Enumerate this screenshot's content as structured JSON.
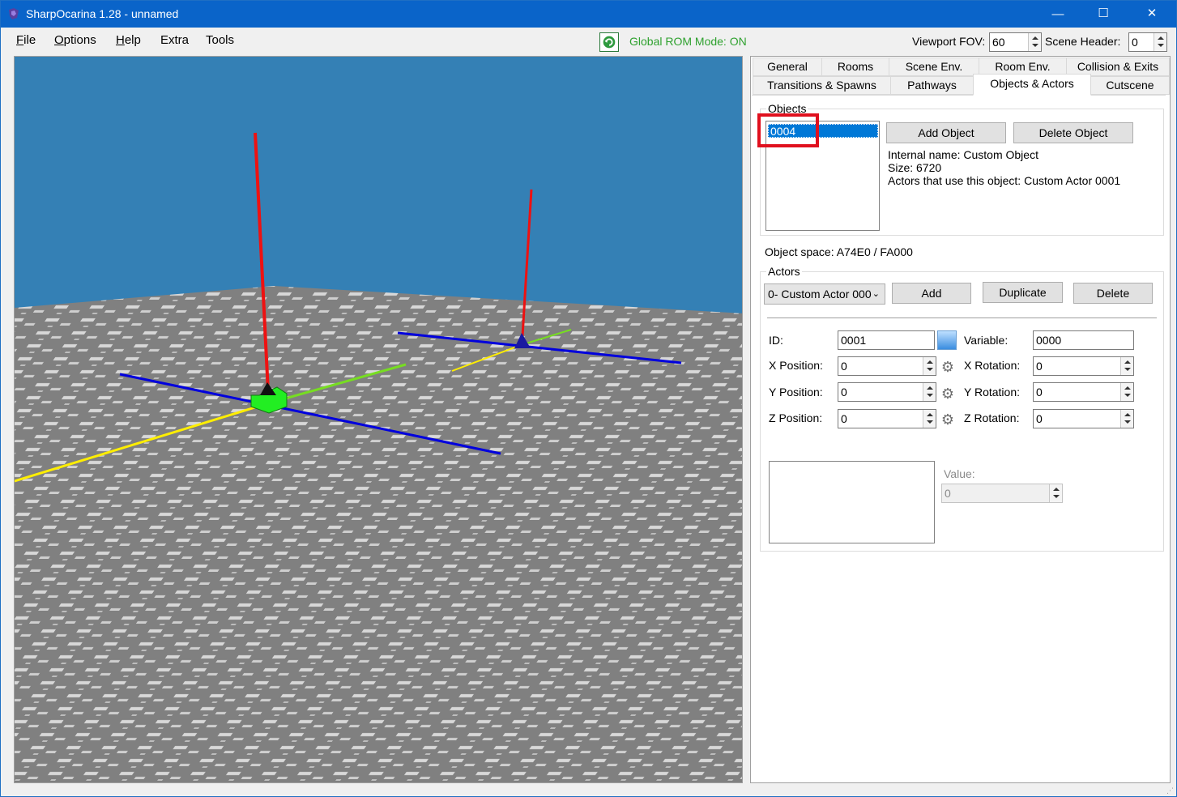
{
  "window": {
    "title": "SharpOcarina 1.28 - unnamed",
    "controls": {
      "minimize": "—",
      "maximize": "☐",
      "close": "✕"
    }
  },
  "menu": {
    "items": [
      {
        "first": "F",
        "rest": "ile"
      },
      {
        "first": "O",
        "rest": "ptions"
      },
      {
        "first": "H",
        "rest": "elp"
      },
      {
        "first": "",
        "rest": "Extra"
      },
      {
        "first": "",
        "rest": "Tools"
      }
    ]
  },
  "toolbar": {
    "rom_mode": "Global ROM Mode: ON",
    "rom_mode_color": "#2ea12e",
    "fov_label": "Viewport FOV:",
    "fov_value": "60",
    "scene_header_label": "Scene Header:",
    "scene_header_value": "0"
  },
  "viewport": {
    "sky_color": "#3480b5",
    "floor_color": "#7e7e7e",
    "axis_colors": {
      "x": "#0000dd",
      "y": "#ee1111",
      "z": "#ffee00",
      "z_alt": "#77dd22"
    }
  },
  "tabs": {
    "row1": [
      "General",
      "Rooms",
      "Scene Env.",
      "Room Env.",
      "Collision & Exits"
    ],
    "row2": [
      "Transitions & Spawns",
      "Pathways",
      "Objects & Actors",
      "Cutscene"
    ],
    "active": "Objects & Actors"
  },
  "objects": {
    "group_title": "Objects",
    "list": [
      "0004"
    ],
    "add_button": "Add Object",
    "delete_button": "Delete Object",
    "internal_name": "Internal name: Custom Object",
    "size": "Size: 6720",
    "used_by": "Actors that use this object: Custom Actor 0001",
    "object_space": "Object space: A74E0 / FA000"
  },
  "actors": {
    "group_title": "Actors",
    "selected": "0- Custom Actor 000",
    "add_button": "Add",
    "duplicate_button": "Duplicate",
    "delete_button": "Delete",
    "id_label": "ID:",
    "id_value": "0001",
    "variable_label": "Variable:",
    "variable_value": "0000",
    "x_pos_label": "X Position:",
    "x_pos": "0",
    "y_pos_label": "Y Position:",
    "y_pos": "0",
    "z_pos_label": "Z Position:",
    "z_pos": "0",
    "x_rot_label": "X Rotation:",
    "x_rot": "0",
    "y_rot_label": "Y Rotation:",
    "y_rot": "0",
    "z_rot_label": "Z Rotation:",
    "z_rot": "0",
    "value_label": "Value:",
    "value": "0"
  }
}
